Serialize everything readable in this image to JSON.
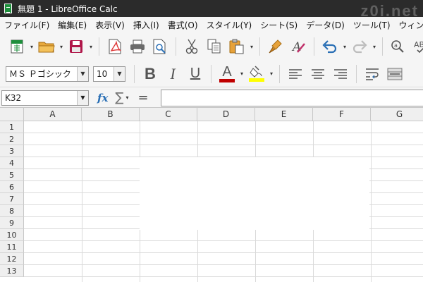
{
  "window": {
    "title": "無題 1 - LibreOffice Calc",
    "watermark": "z0i.net"
  },
  "menu": [
    "ファイル(F)",
    "編集(E)",
    "表示(V)",
    "挿入(I)",
    "書式(O)",
    "スタイル(Y)",
    "シート(S)",
    "データ(D)",
    "ツール(T)",
    "ウィンドウ(W)"
  ],
  "toolbar": {
    "font_name": "ＭＳ Ｐゴシック",
    "font_size": "10",
    "bold": "B",
    "italic": "I",
    "underline": "U",
    "font_color_letter": "A",
    "spell_letter": "A",
    "abc": "AB",
    "accent_colors": {
      "font_color": "#c00000",
      "highlight": "#ffff00",
      "spreadsheet_green": "#1e8f3c"
    }
  },
  "formula": {
    "name_box": "K32",
    "fx": "fx",
    "sigma": "∑",
    "equals": "="
  },
  "columns": [
    "A",
    "B",
    "C",
    "D",
    "E",
    "F",
    "G"
  ],
  "rows": [
    "1",
    "2",
    "3",
    "4",
    "5",
    "6",
    "7",
    "8",
    "9",
    "10",
    "11",
    "12",
    "13"
  ]
}
